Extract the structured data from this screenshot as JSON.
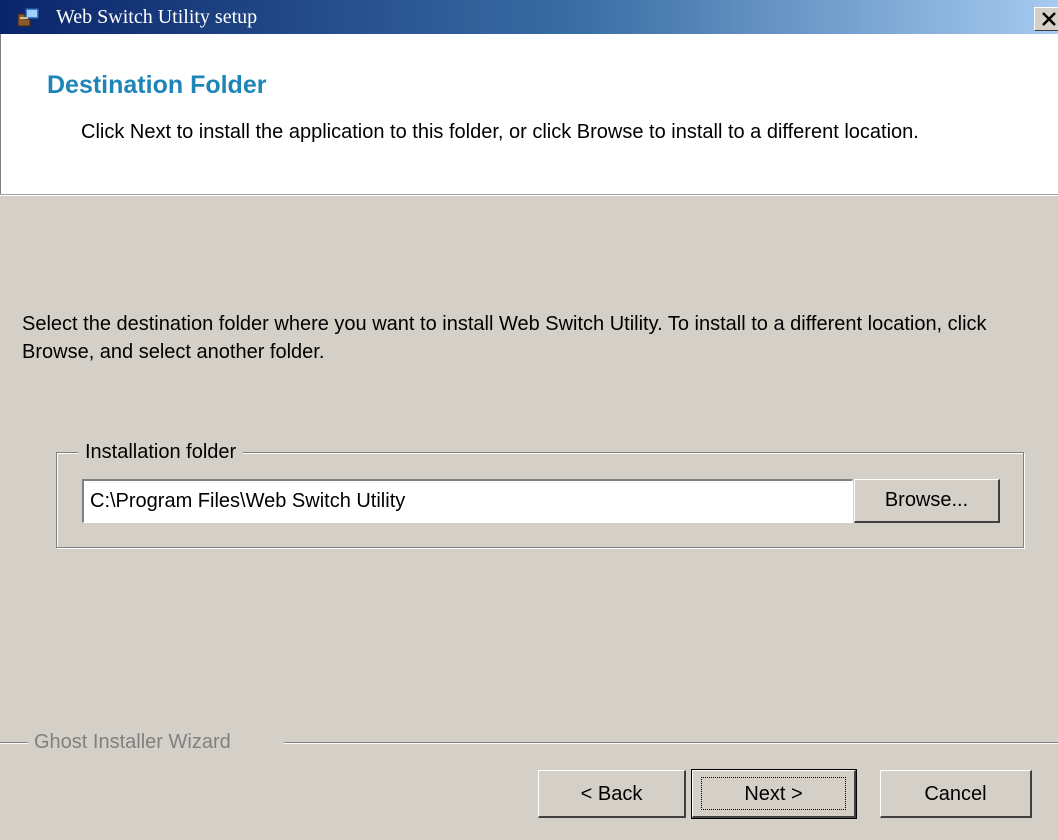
{
  "window": {
    "title": "Web Switch Utility setup",
    "icon": "installer-app-icon"
  },
  "header": {
    "title": "Destination Folder",
    "description": "Click Next to install the application to this folder, or click Browse to install to a different location."
  },
  "body": {
    "instructions": "Select the destination folder where you want to install Web Switch Utility. To install to a different location, click Browse, and select another folder."
  },
  "install_folder": {
    "legend": "Installation folder",
    "value": "C:\\Program Files\\Web Switch Utility",
    "browse_label": "Browse..."
  },
  "footer": {
    "brand": "Ghost Installer Wizard",
    "back_label": "< Back",
    "next_label": "Next >",
    "cancel_label": "Cancel"
  },
  "colors": {
    "title_bar": "#0a246a",
    "header_title": "#1f85b8",
    "dialog_bg": "#d4d0c8"
  }
}
